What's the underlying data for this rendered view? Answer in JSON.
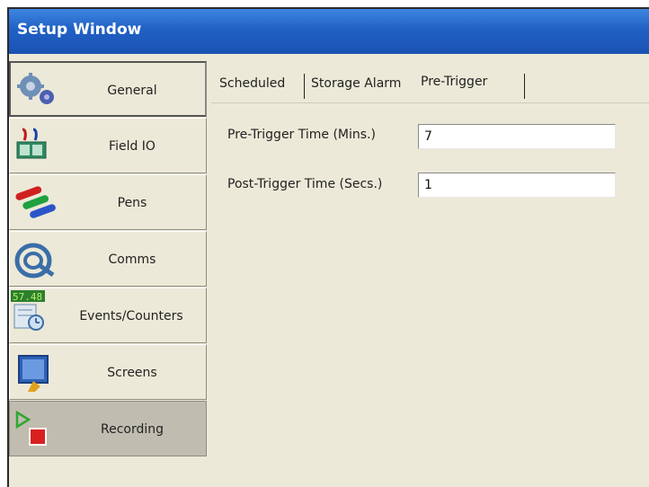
{
  "window": {
    "title": "Setup Window"
  },
  "sidebar": {
    "items": [
      {
        "label": "General",
        "icon": "gears-icon",
        "state": "pressed"
      },
      {
        "label": "Field IO",
        "icon": "field-io-icon",
        "state": "normal"
      },
      {
        "label": "Pens",
        "icon": "pens-icon",
        "state": "normal"
      },
      {
        "label": "Comms",
        "icon": "comms-cable-icon",
        "state": "normal"
      },
      {
        "label": "Events/Counters",
        "icon": "events-counters-icon",
        "state": "normal"
      },
      {
        "label": "Screens",
        "icon": "screens-icon",
        "state": "normal"
      },
      {
        "label": "Recording",
        "icon": "recording-icon",
        "state": "selected"
      }
    ],
    "events_icon_text": "57.48"
  },
  "tabs": [
    {
      "label": "Scheduled",
      "active": false
    },
    {
      "label": "Storage Alarm",
      "active": false
    },
    {
      "label": "Pre-Trigger",
      "active": true
    }
  ],
  "form": {
    "pre_trigger_label": "Pre-Trigger Time (Mins.)",
    "pre_trigger_value": "7",
    "post_trigger_label": "Post-Trigger Time (Secs.)",
    "post_trigger_value": "1"
  },
  "colors": {
    "titlebar": "#2160c4",
    "panel": "#ece9d8",
    "selected_item": "#c0bdb0"
  }
}
